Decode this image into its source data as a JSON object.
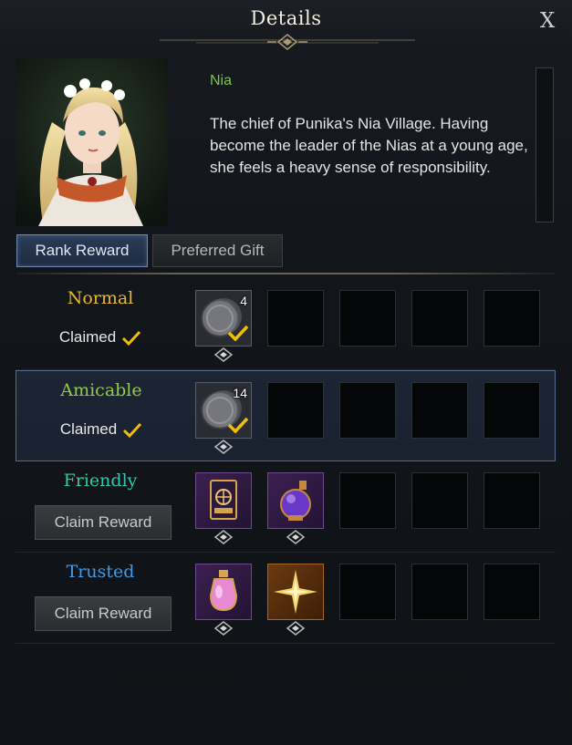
{
  "window": {
    "title": "Details",
    "close_label": "X"
  },
  "npc": {
    "name": "Nia",
    "description": "The chief of Punika's Nia Village. Having become the leader of the Nias at a young age, she feels a heavy sense of responsibility."
  },
  "tabs": [
    {
      "label": "Rank Reward",
      "active": true
    },
    {
      "label": "Preferred Gift",
      "active": false
    }
  ],
  "colors": {
    "normal": "#e9b72a",
    "amicable": "#8fcf3c",
    "friendly": "#2fc9a8",
    "trusted": "#3f9be6",
    "check": "#f0c000"
  },
  "ranks": [
    {
      "name": "Normal",
      "status": "Claimed",
      "rewards": [
        {
          "icon": "silver-coin-icon",
          "qty": "4",
          "claimed": true
        }
      ]
    },
    {
      "name": "Amicable",
      "status": "Claimed",
      "rewards": [
        {
          "icon": "silver-coin-icon",
          "qty": "14",
          "claimed": true
        }
      ]
    },
    {
      "name": "Friendly",
      "action": "Claim Reward",
      "rewards": [
        {
          "icon": "card-pack-icon"
        },
        {
          "icon": "purple-potion-icon"
        }
      ]
    },
    {
      "name": "Trusted",
      "action": "Claim Reward",
      "rewards": [
        {
          "icon": "pink-potion-icon"
        },
        {
          "icon": "star-burst-icon"
        }
      ]
    }
  ]
}
